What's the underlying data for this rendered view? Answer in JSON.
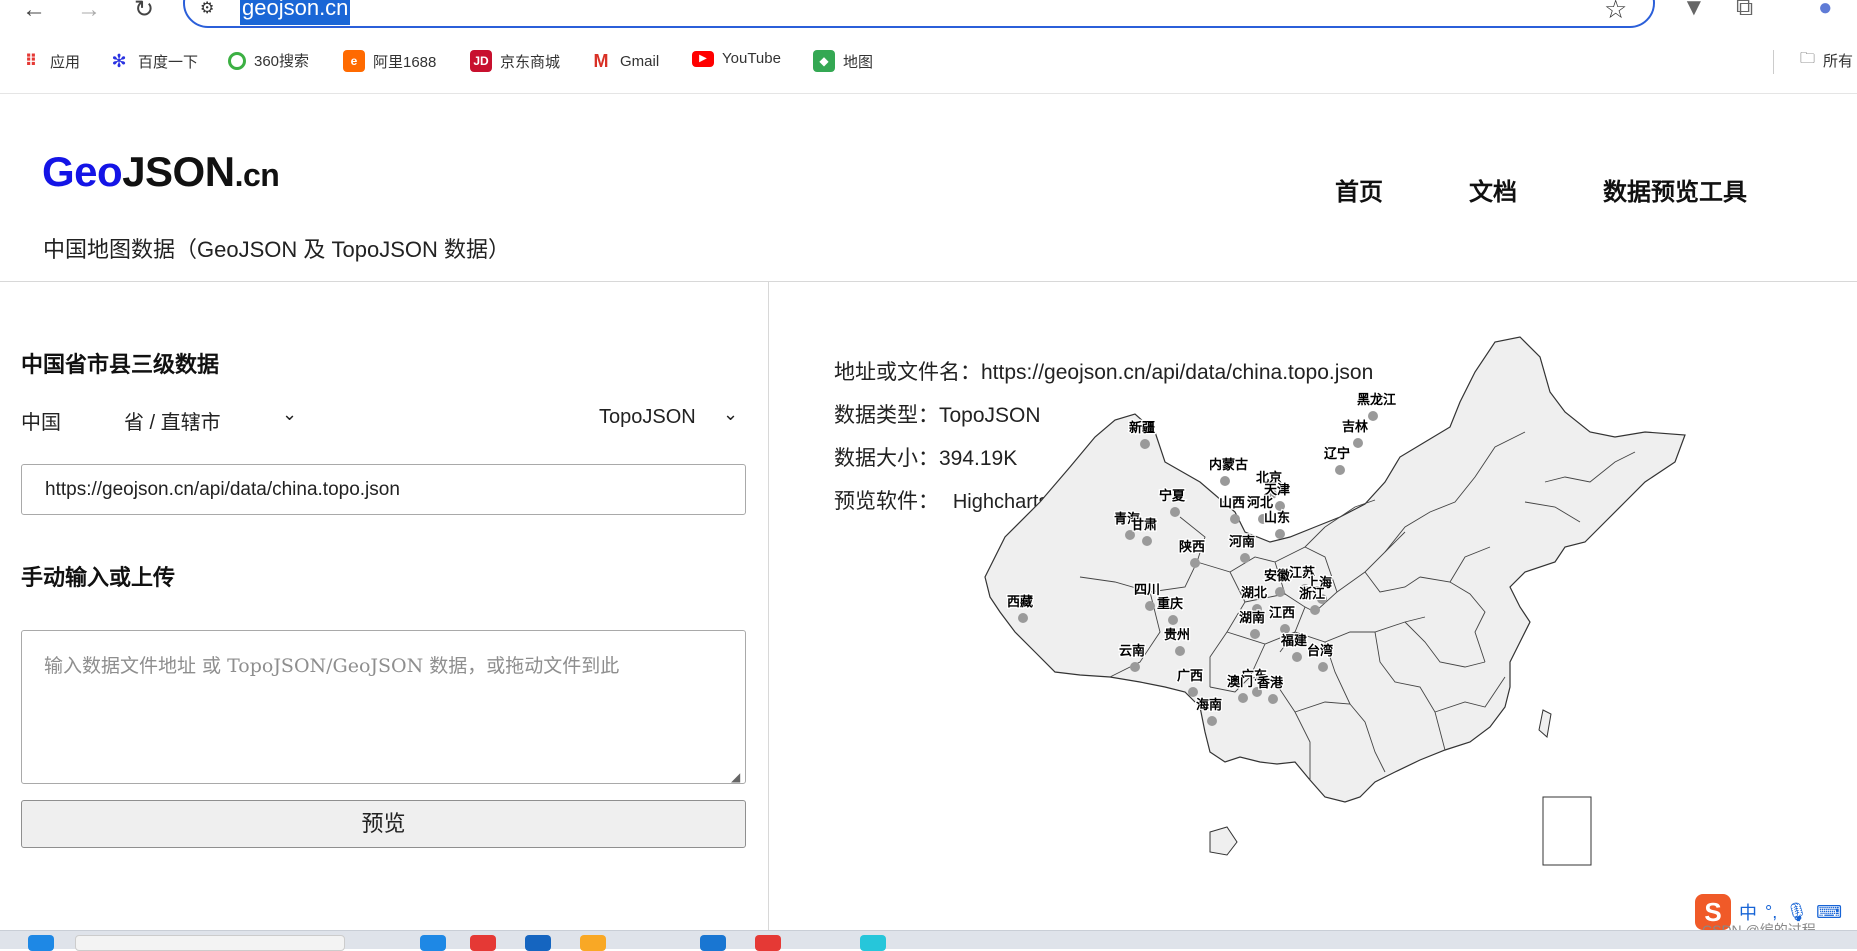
{
  "browser": {
    "url": "geojson.cn",
    "bookmarks": [
      {
        "label": "应用",
        "icon": "apps-grid-icon"
      },
      {
        "label": "百度一下",
        "icon": "baidu-icon"
      },
      {
        "label": "360搜索",
        "icon": "360-search-icon"
      },
      {
        "label": "阿里1688",
        "icon": "alibaba-icon"
      },
      {
        "label": "京东商城",
        "icon": "jd-icon"
      },
      {
        "label": "Gmail",
        "icon": "gmail-icon"
      },
      {
        "label": "YouTube",
        "icon": "youtube-icon"
      },
      {
        "label": "地图",
        "icon": "maps-icon"
      }
    ],
    "bookmarks_folder": "所有"
  },
  "site": {
    "logo_geo": "Geo",
    "logo_json": "JSON",
    "logo_cn": ".cn",
    "subtitle": "中国地图数据（GeoJSON 及 TopoJSON 数据）",
    "nav": [
      "首页",
      "文档",
      "数据预览工具"
    ]
  },
  "left": {
    "section1_title": "中国省市县三级数据",
    "country": "中国",
    "province_select": "省 / 直辖市",
    "format_select": "TopoJSON",
    "url_value": "https://geojson.cn/api/data/china.topo.json",
    "section2_title": "手动输入或上传",
    "textarea_placeholder": "输入数据文件地址 或 TopoJSON/GeoJSON 数据，或拖动文件到此",
    "preview_button": "预览"
  },
  "right": {
    "address_label": "地址或文件名：",
    "address_value": "https://geojson.cn/api/data/china.topo.json",
    "type_label": "数据类型：",
    "type_value": "TopoJSON",
    "size_label": "数据大小：",
    "size_value": "394.19K",
    "software_label": "预览软件：",
    "software_value": "Highcharts Maps",
    "provinces": [
      "新疆",
      "黑龙江",
      "吉林",
      "辽宁",
      "内蒙古",
      "北京",
      "天津",
      "宁夏",
      "山西",
      "河北",
      "青海",
      "甘肃",
      "山东",
      "陕西",
      "河南",
      "安徽",
      "江苏",
      "上海",
      "四川",
      "湖北",
      "浙江",
      "重庆",
      "西藏",
      "湖南",
      "江西",
      "贵州",
      "福建",
      "云南",
      "台湾",
      "广西",
      "广东",
      "澳门",
      "香港",
      "海南"
    ]
  },
  "system": {
    "ime_label": "中",
    "watermark": "CSDN @编的过程"
  }
}
